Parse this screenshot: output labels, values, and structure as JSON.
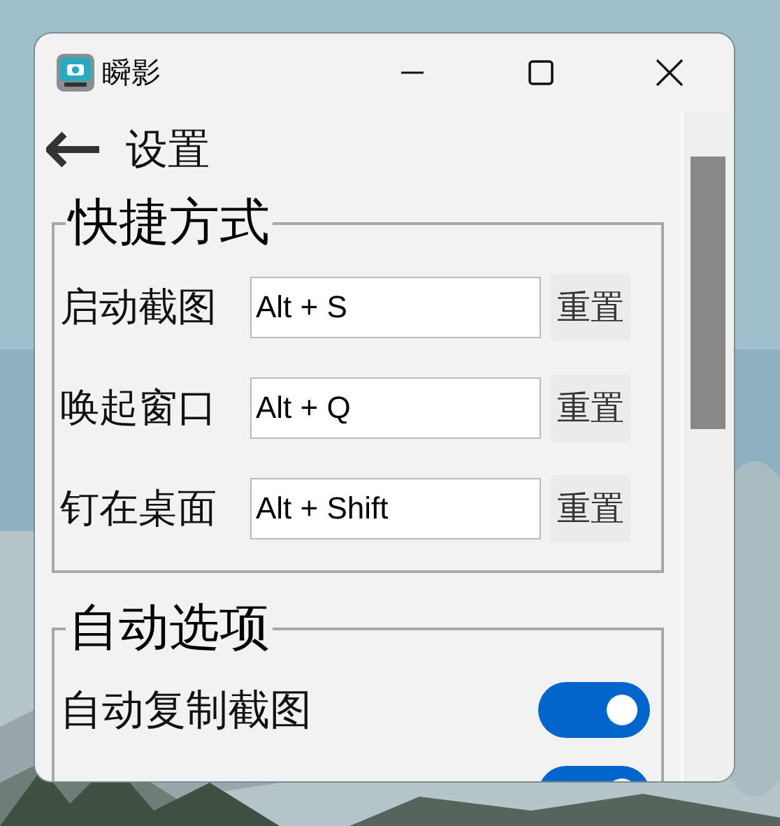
{
  "window": {
    "title": "瞬影"
  },
  "header": {
    "title": "设置"
  },
  "groups": [
    {
      "title": "快捷方式",
      "items": [
        {
          "kind": "shortcut",
          "label": "启动截图",
          "value": "Alt + S",
          "button": "重置"
        },
        {
          "kind": "shortcut",
          "label": "唤起窗口",
          "value": "Alt + Q",
          "button": "重置"
        },
        {
          "kind": "shortcut",
          "label": "钉在桌面",
          "value": "Alt + Shift",
          "button": "重置"
        }
      ]
    },
    {
      "title": "自动选项",
      "items": [
        {
          "kind": "toggle",
          "label": "自动复制截图",
          "on": true
        },
        {
          "kind": "toggle",
          "on": true
        }
      ]
    }
  ]
}
